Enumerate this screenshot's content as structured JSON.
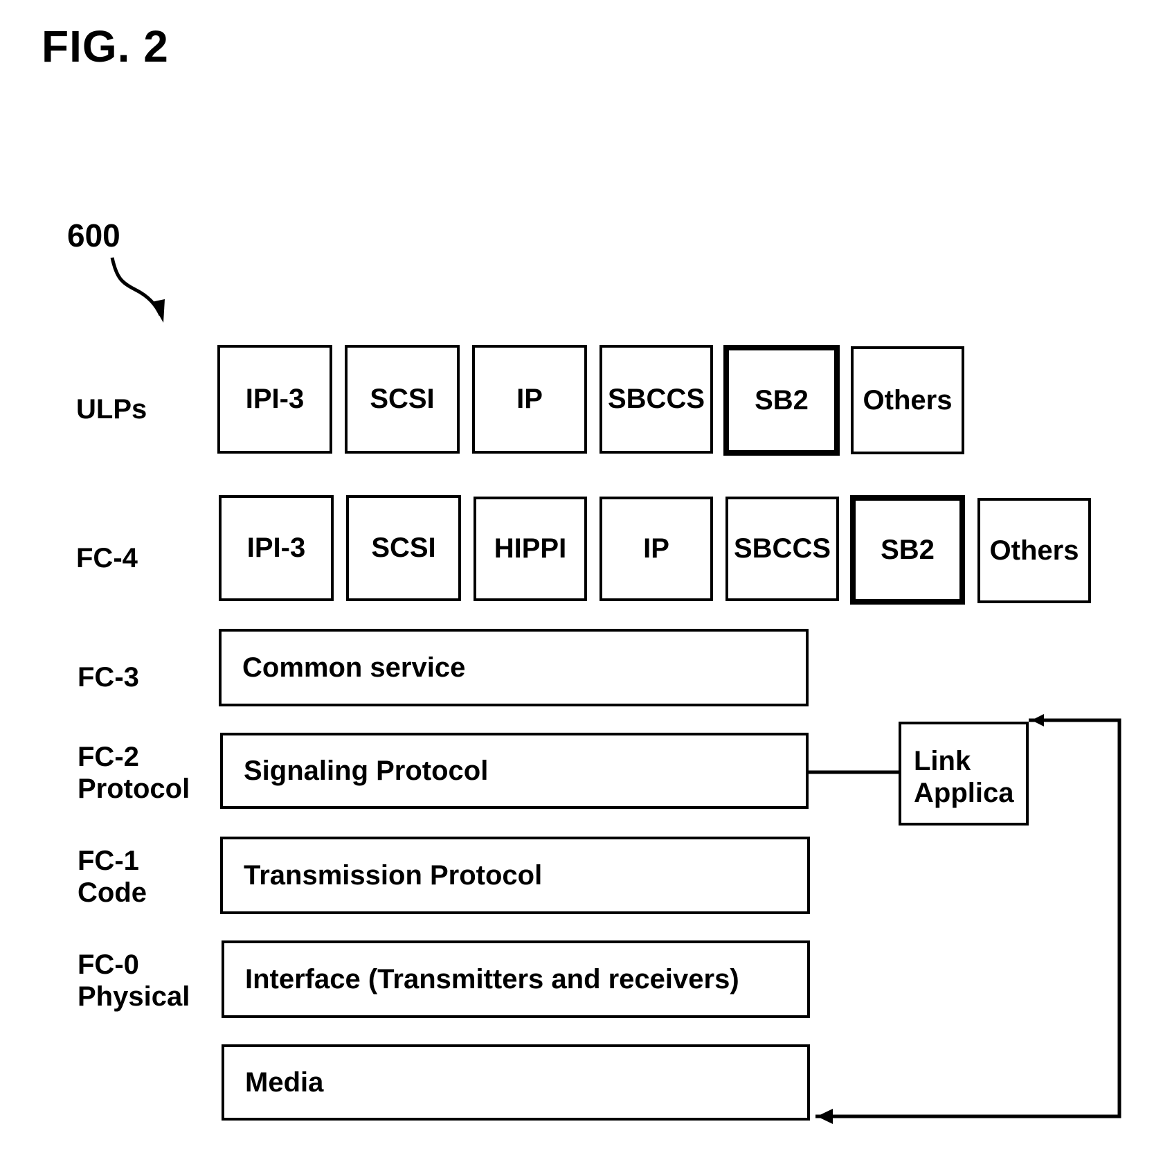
{
  "figure": {
    "title": "FIG. 2",
    "reference_number": "600"
  },
  "layers": {
    "ulps": {
      "label": "ULPs",
      "boxes": [
        "IPI-3",
        "SCSI",
        "IP",
        "SBCCS",
        "SB2",
        "Others"
      ]
    },
    "fc4": {
      "label": "FC-4",
      "boxes": [
        "IPI-3",
        "SCSI",
        "HIPPI",
        "IP",
        "SBCCS",
        "SB2",
        "Others"
      ]
    },
    "fc3": {
      "label": "FC-3",
      "box": "Common service"
    },
    "fc2": {
      "label_line1": "FC-2",
      "label_line2": "Protocol",
      "box": "Signaling Protocol"
    },
    "fc1": {
      "label_line1": "FC-1",
      "label_line2": "Code",
      "box": "Transmission Protocol"
    },
    "fc0": {
      "label_line1": "FC-0",
      "label_line2": "Physical",
      "box": "Interface (Transmitters and receivers)"
    },
    "media": {
      "box": "Media"
    }
  },
  "link_application": {
    "line1": "Link",
    "line2": "Applica"
  }
}
